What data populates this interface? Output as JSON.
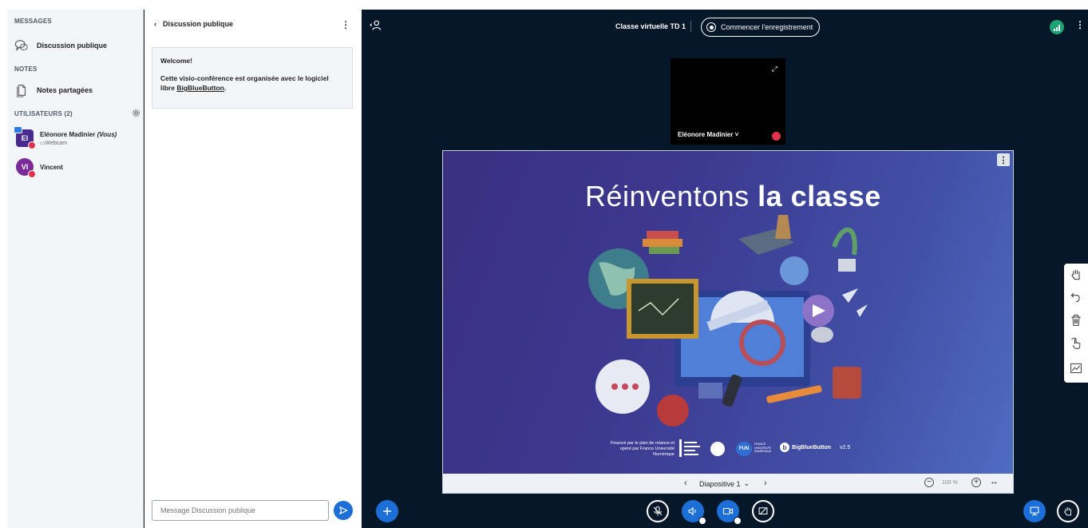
{
  "sidebar": {
    "messages_title": "MESSAGES",
    "public_chat_label": "Discussion publique",
    "notes_title": "NOTES",
    "shared_notes_label": "Notes partagées",
    "users_title": "UTILISATEURS (2)",
    "users": [
      {
        "initials": "El",
        "name": "Eléonore Madinier",
        "you_suffix": "(Vous)",
        "sub": "Webcam"
      },
      {
        "initials": "VI",
        "name": "Vincent",
        "sub": ""
      }
    ]
  },
  "chat": {
    "header": "Discussion publique",
    "welcome_title": "Welcome!",
    "welcome_text": "Cette visio-conférence est organisée avec le logiciel libre",
    "welcome_link": "BigBlueButton",
    "welcome_end": ".",
    "input_placeholder": "Message Discussion publique"
  },
  "main": {
    "meeting_title": "Classe virtuelle TD 1",
    "record_label": "Commencer l'enregistrement",
    "webcam_name": "Eléonore Madinier",
    "slide": {
      "title_light": "Réinventons",
      "title_bold": "la classe",
      "credit": "Financé par le plan de relance et opéré par France Université Numérique",
      "logo_fun": "FUN",
      "logo_fun_text": "FRANCE UNIVERSITÉ NUMÉRIQUE",
      "logo_bbb": "BigBlueButton",
      "logo_bbb_version": "v2.5"
    },
    "slide_bar": {
      "slide_label": "Diapositive 1",
      "zoom": "100 %"
    }
  },
  "colors": {
    "accent": "#1b6fd6",
    "background_dark": "#06172a",
    "connection_ok": "#1ca374",
    "muted_badge": "#e0334b"
  }
}
